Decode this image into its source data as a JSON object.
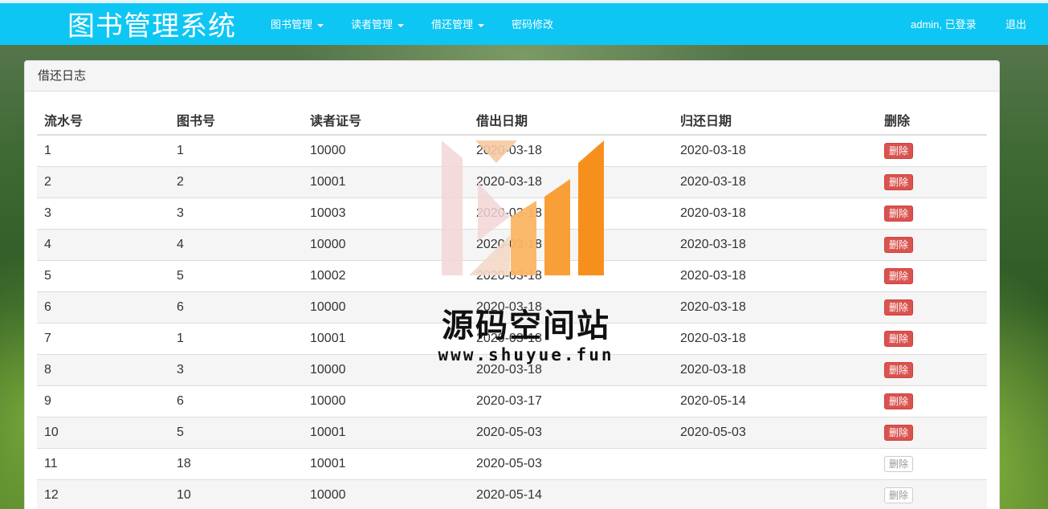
{
  "header": {
    "brand": "图书管理系统",
    "nav": [
      {
        "label": "图书管理",
        "dropdown": true
      },
      {
        "label": "读者管理",
        "dropdown": true
      },
      {
        "label": "借还管理",
        "dropdown": true
      },
      {
        "label": "密码修改",
        "dropdown": false
      }
    ],
    "user_status": "admin, 已登录",
    "logout": "退出",
    "accent_color": "#0ec6f3"
  },
  "panel": {
    "title": "借还日志",
    "columns": [
      "流水号",
      "图书号",
      "读者证号",
      "借出日期",
      "归还日期",
      "删除"
    ],
    "rows": [
      {
        "serial": "1",
        "book_id": "1",
        "reader_id": "10000",
        "lend_date": "2020-03-18",
        "return_date": "2020-03-18",
        "action": "删除",
        "enabled": true
      },
      {
        "serial": "2",
        "book_id": "2",
        "reader_id": "10001",
        "lend_date": "2020-03-18",
        "return_date": "2020-03-18",
        "action": "删除",
        "enabled": true
      },
      {
        "serial": "3",
        "book_id": "3",
        "reader_id": "10003",
        "lend_date": "2020-03-18",
        "return_date": "2020-03-18",
        "action": "删除",
        "enabled": true
      },
      {
        "serial": "4",
        "book_id": "4",
        "reader_id": "10000",
        "lend_date": "2020-03-18",
        "return_date": "2020-03-18",
        "action": "删除",
        "enabled": true
      },
      {
        "serial": "5",
        "book_id": "5",
        "reader_id": "10002",
        "lend_date": "2020-03-18",
        "return_date": "2020-03-18",
        "action": "删除",
        "enabled": true
      },
      {
        "serial": "6",
        "book_id": "6",
        "reader_id": "10000",
        "lend_date": "2020-03-18",
        "return_date": "2020-03-18",
        "action": "删除",
        "enabled": true
      },
      {
        "serial": "7",
        "book_id": "1",
        "reader_id": "10001",
        "lend_date": "2020-03-18",
        "return_date": "2020-03-18",
        "action": "删除",
        "enabled": true
      },
      {
        "serial": "8",
        "book_id": "3",
        "reader_id": "10000",
        "lend_date": "2020-03-18",
        "return_date": "2020-03-18",
        "action": "删除",
        "enabled": true
      },
      {
        "serial": "9",
        "book_id": "6",
        "reader_id": "10000",
        "lend_date": "2020-03-17",
        "return_date": "2020-05-14",
        "action": "删除",
        "enabled": true
      },
      {
        "serial": "10",
        "book_id": "5",
        "reader_id": "10001",
        "lend_date": "2020-05-03",
        "return_date": "2020-05-03",
        "action": "删除",
        "enabled": true
      },
      {
        "serial": "11",
        "book_id": "18",
        "reader_id": "10001",
        "lend_date": "2020-05-03",
        "return_date": "",
        "action": "删除",
        "enabled": false
      },
      {
        "serial": "12",
        "book_id": "10",
        "reader_id": "10000",
        "lend_date": "2020-05-14",
        "return_date": "",
        "action": "删除",
        "enabled": false
      }
    ]
  },
  "watermark": {
    "title": "源码空间站",
    "url": "www.shuyue.fun",
    "logo_icon": "bar-chart-logo-icon"
  }
}
